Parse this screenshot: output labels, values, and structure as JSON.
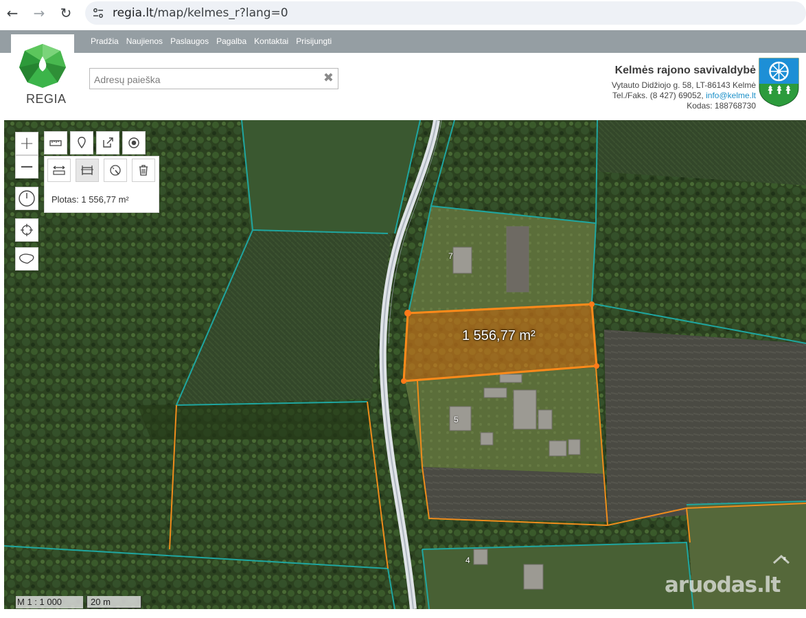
{
  "browser": {
    "back_icon": "arrow-left-icon",
    "forward_icon": "arrow-right-icon",
    "reload_icon": "reload-icon",
    "url_host": "regia.lt",
    "url_path": "/map/kelmes_r?lang=0"
  },
  "site": {
    "logo_text": "REGIA",
    "menu": [
      "Pradžia",
      "Naujienos",
      "Paslaugos",
      "Pagalba",
      "Kontaktai",
      "Prisijungti"
    ],
    "search_placeholder": "Adresų paieška",
    "search_clear": "✖"
  },
  "municipality": {
    "name": "Kelmės rajono savivaldybė",
    "address": "Vytauto Didžiojo g. 58, LT-86143 Kelmė",
    "phone_prefix": "Tel./Faks. (8 427) 69052,",
    "email": "info@kelme.lt",
    "code": "Kodas: 188768730"
  },
  "map": {
    "measure_result": "Plotas: 1 556,77 m²",
    "polygon_label": "1 556,77 m²",
    "house_numbers": [
      "7",
      "5",
      "4"
    ],
    "scale_ratio": "M 1 : 1 000",
    "scale_bar": "20 m",
    "watermark": "aruodas.lt",
    "colors": {
      "parcel_teal": "#1fa6a0",
      "parcel_orange": "#f08c1c",
      "measure_fill": "#d97a1c",
      "measure_stroke": "#ff8a1a"
    }
  }
}
